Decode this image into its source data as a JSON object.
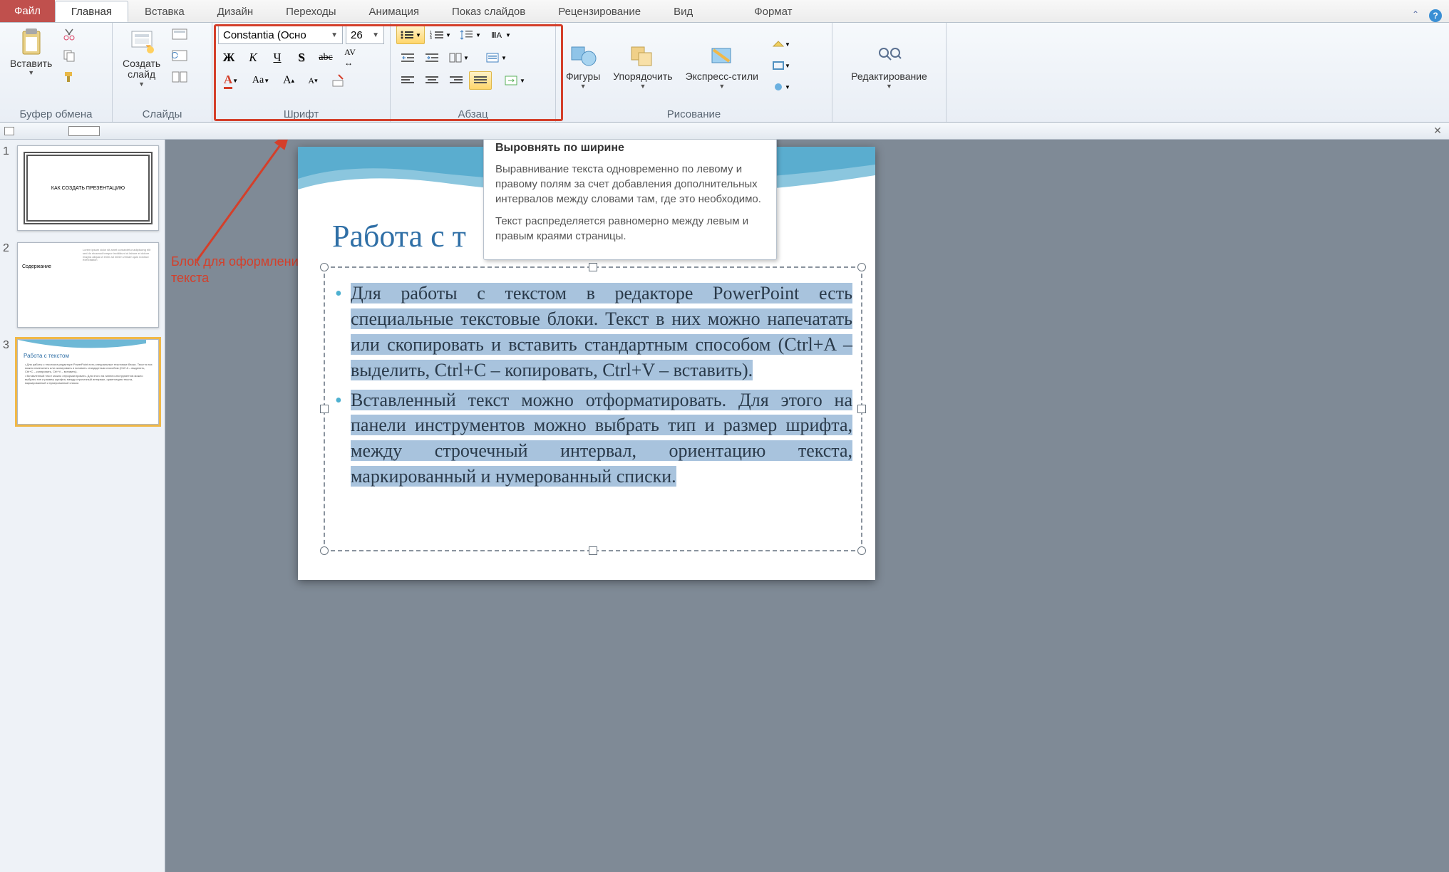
{
  "tabs": {
    "file": "Файл",
    "items": [
      "Главная",
      "Вставка",
      "Дизайн",
      "Переходы",
      "Анимация",
      "Показ слайдов",
      "Рецензирование",
      "Вид",
      "Формат"
    ],
    "active_index": 0
  },
  "ribbon": {
    "clipboard": {
      "label": "Буфер обмена",
      "paste": "Вставить"
    },
    "slides": {
      "label": "Слайды",
      "new_slide": "Создать\nслайд"
    },
    "font": {
      "label": "Шрифт",
      "font_name": "Constantia (Осно",
      "font_size": "26"
    },
    "paragraph": {
      "label": "Абзац"
    },
    "drawing": {
      "label": "Рисование",
      "shapes": "Фигуры",
      "arrange": "Упорядочить",
      "quick_styles": "Экспресс-стили"
    },
    "editing": {
      "label": "Редактирование"
    }
  },
  "annotation": {
    "text": "Блок для оформления\nтекста"
  },
  "tooltip": {
    "title": "Выровнять по ширине",
    "p1": "Выравнивание текста одновременно по левому и правому полям за счет добавления дополнительных интервалов между словами там, где это необходимо.",
    "p2": "Текст распределяется равномерно между левым и правым краями страницы."
  },
  "thumbnails": [
    {
      "num": "1",
      "title": "КАК СОЗДАТЬ ПРЕЗЕНТАЦИЮ"
    },
    {
      "num": "2",
      "title": "Содержание"
    },
    {
      "num": "3",
      "title": "Работа с текстом"
    }
  ],
  "slide": {
    "title": "Работа с т",
    "p1": "Для работы с текстом в редакторе PowerPoint есть специальные текстовые блоки. Текст в них можно напечатать или скопировать и вставить стандартным способом (Ctrl+A – выделить, Ctrl+C – копировать, Ctrl+V – вставить).",
    "p2": "Вставленный текст можно отформатировать. Для этого на панели инструментов можно выбрать тип и размер шрифта, между строчечный интервал, ориентацию текста, маркированный и нумерованный списки."
  }
}
